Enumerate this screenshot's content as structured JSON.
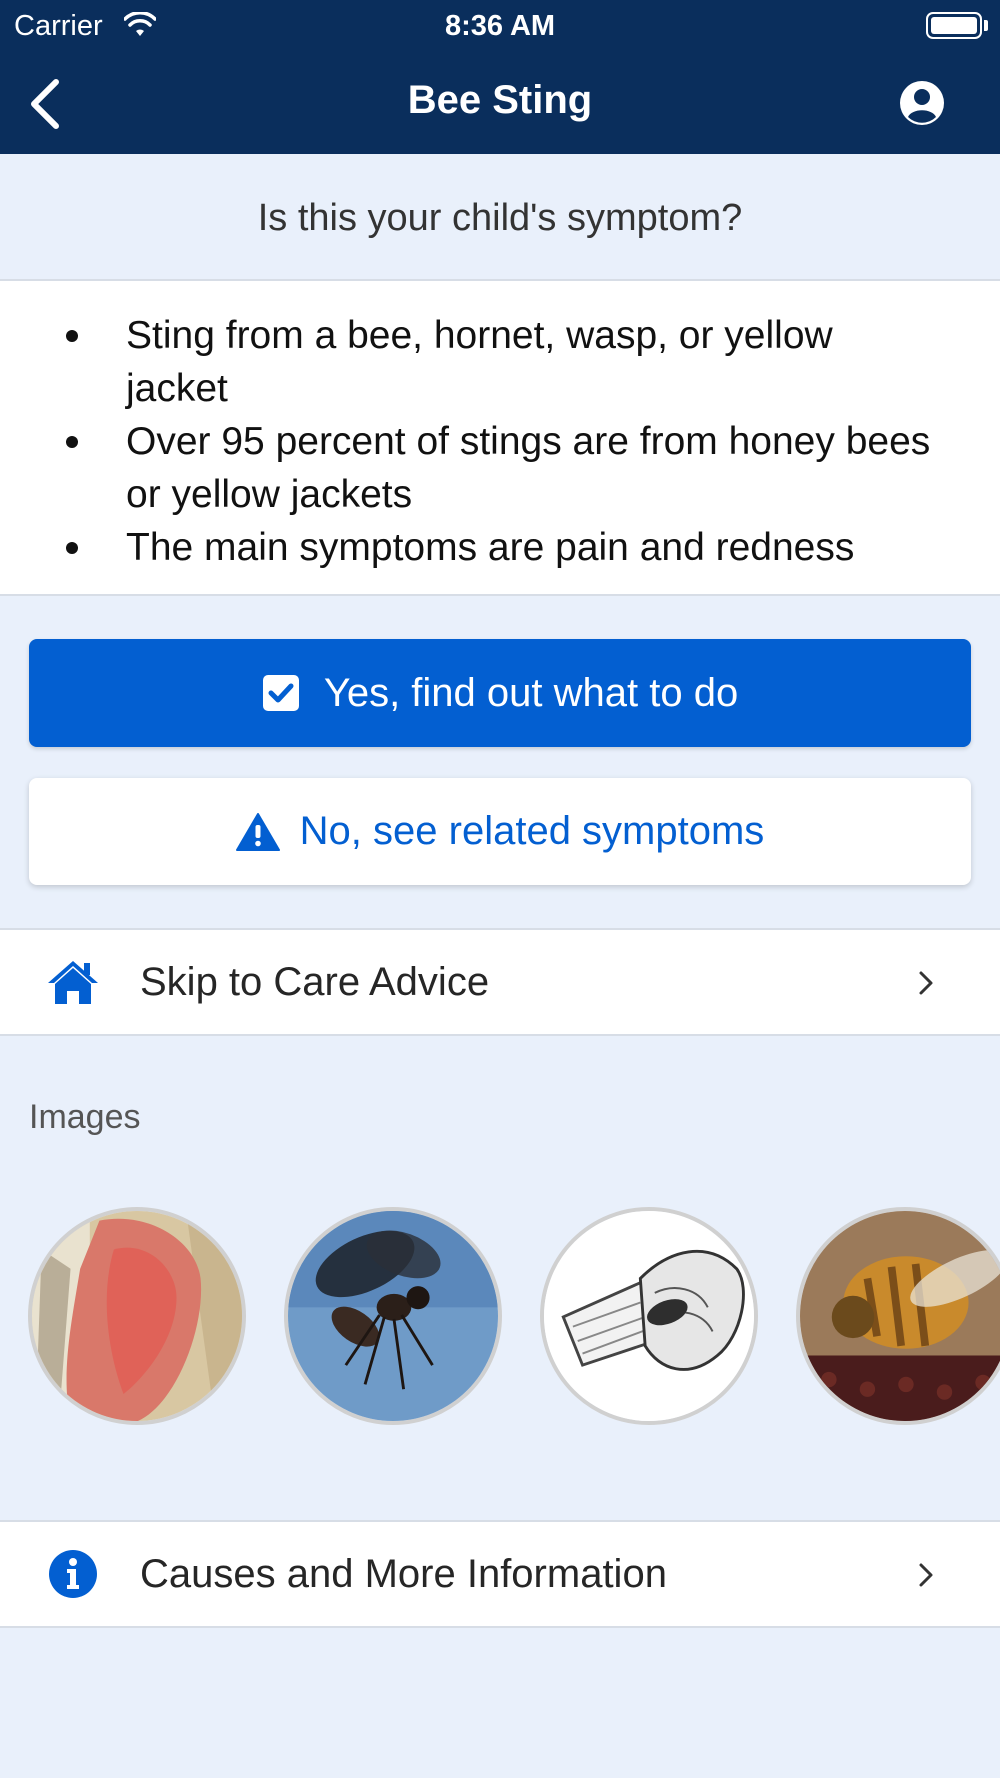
{
  "status_bar": {
    "carrier": "Carrier",
    "time": "8:36 AM"
  },
  "nav": {
    "title": "Bee Sting",
    "back_icon": "chevron-left-icon",
    "profile_icon": "user-circle-icon"
  },
  "question": "Is this your child's symptom?",
  "symptoms": [
    "Sting from a bee, hornet, wasp, or yellow jacket",
    "Over 95 percent of stings are from honey bees or yellow jackets",
    "The main symptoms are pain and redness"
  ],
  "actions": {
    "yes_label": "Yes, find out what to do",
    "no_label": "No, see related symptoms"
  },
  "skip_row": {
    "label": "Skip to Care Advice",
    "icon": "home-icon"
  },
  "images": {
    "heading": "Images",
    "items": [
      "red-swollen-finger",
      "wasp",
      "scraping-stinger-drawing",
      "honey-bee"
    ]
  },
  "causes_row": {
    "label": "Causes and More Information",
    "icon": "info-icon"
  },
  "colors": {
    "nav_background": "#0a2e5c",
    "page_background": "#e9f0fb",
    "primary_blue": "#035fd1"
  }
}
